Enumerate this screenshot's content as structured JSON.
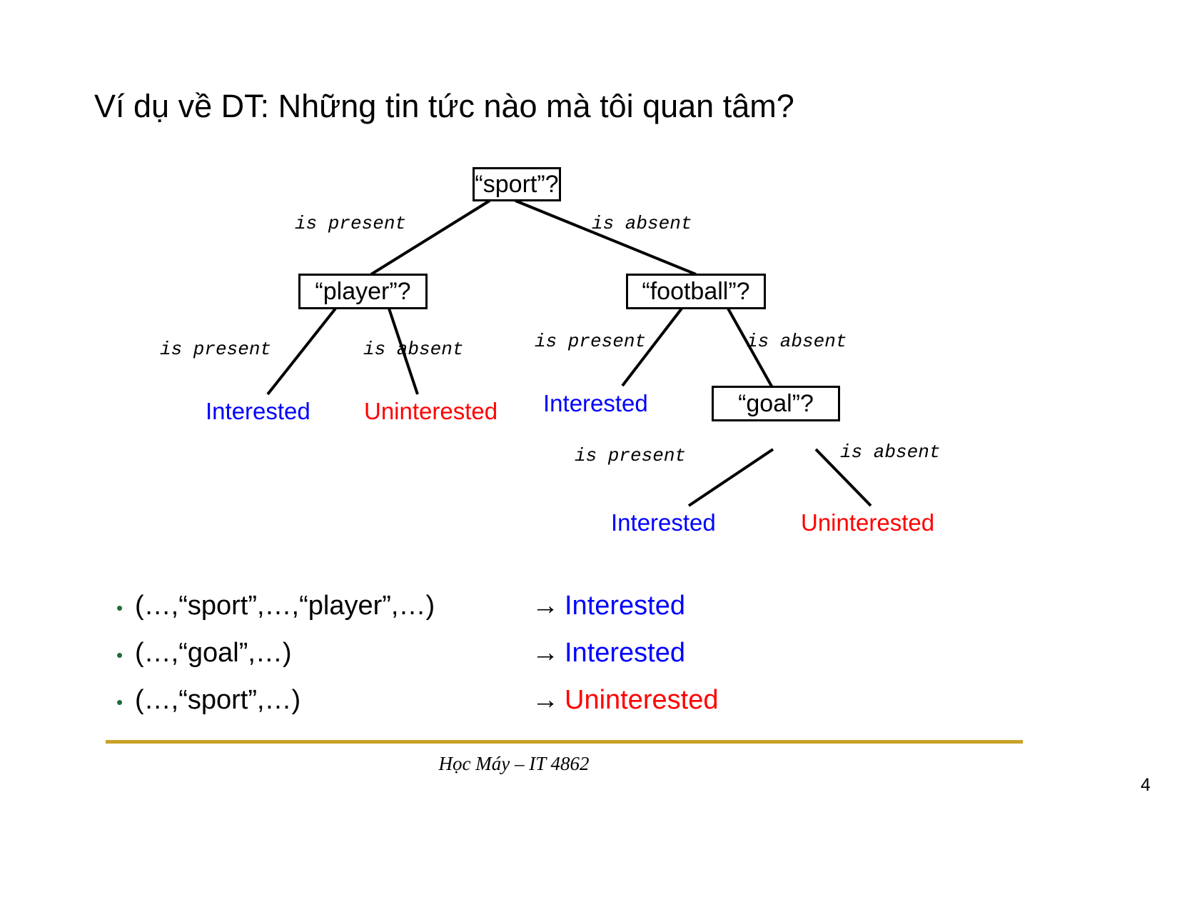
{
  "slide": {
    "title": "Ví dụ về DT:  Những tin tức nào mà tôi quan tâm?",
    "footer_text": "Học Máy – IT 4862",
    "page_number": "4",
    "accent_color": "#c9a227",
    "interested_color": "#0000ff",
    "uninterested_color": "#ff0000",
    "bullet_color": "#1f6b3b"
  },
  "tree": {
    "nodes": [
      {
        "id": "root",
        "label": "“sport”?"
      },
      {
        "id": "player",
        "label": "“player”?"
      },
      {
        "id": "football",
        "label": "“football”?"
      },
      {
        "id": "goal",
        "label": "“goal”?"
      }
    ],
    "edge_labels": {
      "root_left": "is present",
      "root_right": "is absent",
      "player_left": "is present",
      "player_right": "is absent",
      "football_left": "is present",
      "football_right": "is absent",
      "goal_left": "is present",
      "goal_right": "is absent"
    },
    "leaves": [
      {
        "id": "leaf-player-present",
        "label": "Interested",
        "class": "interested"
      },
      {
        "id": "leaf-player-absent",
        "label": "Uninterested",
        "class": "uninterested"
      },
      {
        "id": "leaf-football-present",
        "label": "Interested",
        "class": "interested"
      },
      {
        "id": "leaf-goal-present",
        "label": "Interested",
        "class": "interested"
      },
      {
        "id": "leaf-goal-absent",
        "label": "Uninterested",
        "class": "uninterested"
      }
    ]
  },
  "examples": {
    "bullet_char": "•",
    "arrow": "→",
    "rows": [
      {
        "pattern": "(…,“sport”,…,“player”,…)",
        "arrow": "→",
        "result": "Interested",
        "result_class": "interested"
      },
      {
        "pattern": "(…,“goal”,…)",
        "arrow": "→",
        "result": "Interested",
        "result_class": "interested"
      },
      {
        "pattern": "(…,“sport”,…)",
        "arrow": "→",
        "result": "Uninterested",
        "result_class": "uninterested"
      }
    ]
  }
}
